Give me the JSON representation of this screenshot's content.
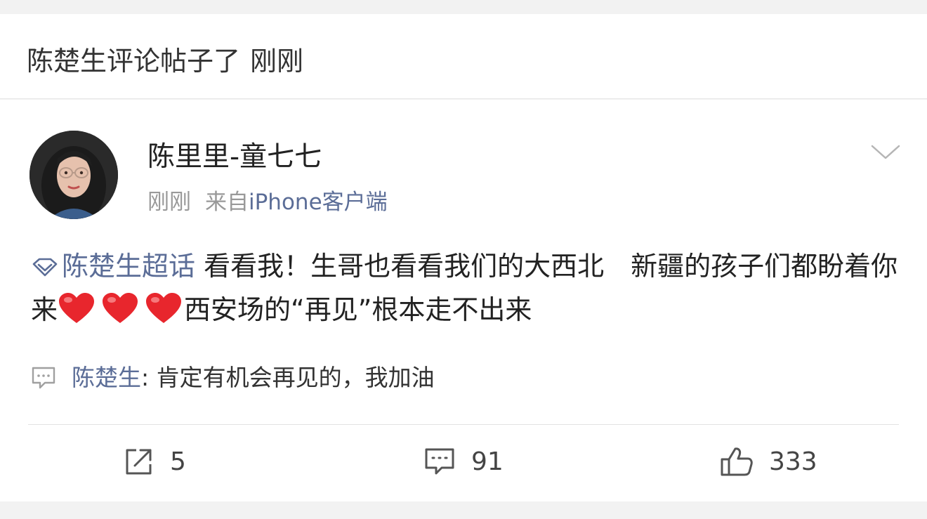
{
  "notification": {
    "actor": "陈楚生",
    "action": "评论帖子了",
    "time": "刚刚"
  },
  "post": {
    "author": "陈里里-童七七",
    "time": "刚刚",
    "from_label": "来自",
    "client": "iPhone客户端",
    "topic": "陈楚生超话",
    "text_part1": "看看我！生哥也看看我们的大西北　新疆的孩子们都盼着你来",
    "hearts": [
      "heart-emoji",
      "heart-emoji",
      "heart-emoji"
    ],
    "text_part2": "西安场的“再见”根本走不出来"
  },
  "reply": {
    "author": "陈楚生",
    "separator": ": ",
    "text": "肯定有机会再见的，我加油"
  },
  "actions": {
    "repost_count": "5",
    "comment_count": "91",
    "like_count": "333"
  },
  "icons": {
    "more": "chevron-down-icon",
    "topic": "super-topic-diamond-icon",
    "reply": "comment-bubble-icon",
    "repost": "repost-icon",
    "comment": "comment-icon",
    "like": "thumbs-up-icon"
  },
  "colors": {
    "link": "#5b6d97",
    "heart": "#e8262d",
    "text": "#222222",
    "muted": "#999999",
    "background": "#f2f2f2"
  }
}
